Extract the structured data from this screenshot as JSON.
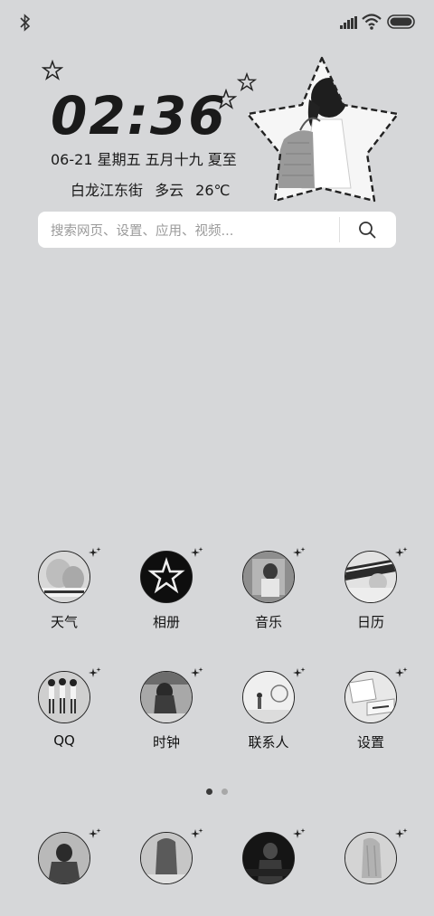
{
  "status_bar": {
    "bluetooth_icon": "bluetooth-icon",
    "signal_icon": "signal-icon",
    "wifi_icon": "wifi-icon",
    "battery_icon": "battery-icon"
  },
  "widget": {
    "time": "02:36",
    "date": "06-21 星期五  五月十九 夏至",
    "weather": "白龙江东街  多云  26℃"
  },
  "search": {
    "placeholder": "搜索网页、设置、应用、视频..."
  },
  "apps": [
    {
      "label": "天气"
    },
    {
      "label": "相册"
    },
    {
      "label": "音乐"
    },
    {
      "label": "日历"
    },
    {
      "label": "QQ"
    },
    {
      "label": "时钟"
    },
    {
      "label": "联系人"
    },
    {
      "label": "设置"
    }
  ],
  "page_indicator": {
    "current": 1,
    "total": 2
  },
  "colors": {
    "background": "#d6d7d9",
    "search_bg": "#ffffff",
    "text": "#1a1a1a",
    "dot_active": "#3a3a3a",
    "dot_inactive": "#a8a8a8"
  }
}
